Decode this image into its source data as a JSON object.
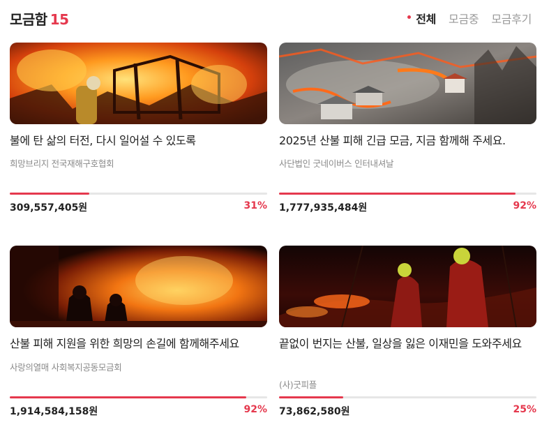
{
  "header": {
    "title": "모금함",
    "count": "15",
    "filters": [
      {
        "label": "전체",
        "active": true
      },
      {
        "label": "모금중",
        "active": false
      },
      {
        "label": "모금후기",
        "active": false
      }
    ]
  },
  "cards": [
    {
      "title": "불에 탄 삶의 터전, 다시 일어설 수 있도록",
      "org": "희망브리지 전국재해구호협회",
      "amount": "309,557,405원",
      "percent": "31%",
      "progress": 0.31
    },
    {
      "title": "2025년 산불 피해 긴급 모금, 지금 함께해 주세요.",
      "org": "사단법인 굿네이버스 인터내셔날",
      "amount": "1,777,935,484원",
      "percent": "92%",
      "progress": 0.92
    },
    {
      "title": "산불 피해 지원을 위한 희망의 손길에 함께해주세요",
      "org": "사랑의열매 사회복지공동모금회",
      "amount": "1,914,584,158원",
      "percent": "92%",
      "progress": 0.92
    },
    {
      "title": "끝없이 번지는 산불, 일상을 잃은 이재민을 도와주세요",
      "org": "(사)굿피플",
      "amount": "73,862,580원",
      "percent": "25%",
      "progress": 0.25
    }
  ],
  "colors": {
    "accent": "#e5384d",
    "track": "#e6e6e6",
    "muted": "#8a8a8a"
  }
}
